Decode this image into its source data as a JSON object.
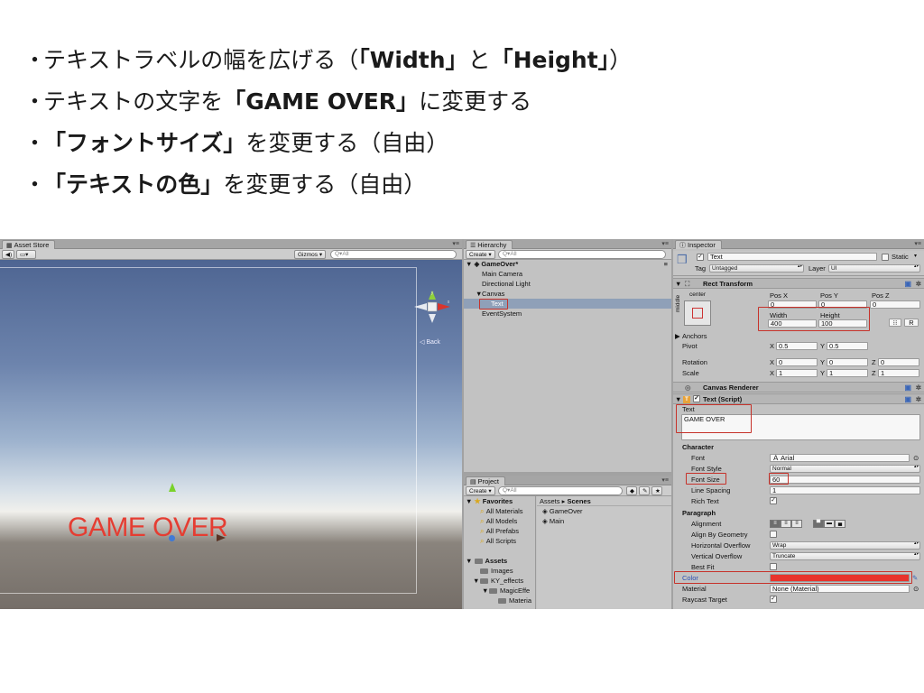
{
  "slide": {
    "bullets": [
      {
        "bullet": "・",
        "parts": [
          {
            "t": "テキストラベルの幅を広げる（",
            "b": false
          },
          {
            "t": "「Width」",
            "b": true
          },
          {
            "t": "と",
            "b": false
          },
          {
            "t": "「Height」",
            "b": true
          },
          {
            "t": "）",
            "b": false
          }
        ]
      },
      {
        "bullet": "・",
        "parts": [
          {
            "t": "テキストの文字を",
            "b": false
          },
          {
            "t": "「GAME OVER」",
            "b": true
          },
          {
            "t": "に変更する",
            "b": false
          }
        ]
      },
      {
        "bullet": "・",
        "parts": [
          {
            "t": "「フォントサイズ」",
            "b": true
          },
          {
            "t": "を変更する（自由）",
            "b": false
          }
        ]
      },
      {
        "bullet": "・",
        "parts": [
          {
            "t": "「テキストの色」",
            "b": true
          },
          {
            "t": "を変更する（自由）",
            "b": false
          }
        ]
      }
    ]
  },
  "scene": {
    "tab": "Asset Store",
    "gizmos": "Gizmos ▾",
    "search_placeholder": "Q▾All",
    "game_text": "GAME OVER",
    "text_color": "#e53d32",
    "back_label": "◁ Back",
    "axis_y": "y",
    "axis_x": "x"
  },
  "hierarchy": {
    "tab": "Hierarchy",
    "create": "Create ▾",
    "search_placeholder": "Q▾All",
    "scene_name": "GameOver*",
    "items": [
      {
        "label": "Main Camera",
        "depth": 1,
        "selected": false
      },
      {
        "label": "Directional Light",
        "depth": 1,
        "selected": false
      },
      {
        "label": "Canvas",
        "depth": 1,
        "selected": false,
        "expand": "▼"
      },
      {
        "label": "Text",
        "depth": 2,
        "selected": true
      },
      {
        "label": "EventSystem",
        "depth": 1,
        "selected": false
      }
    ]
  },
  "project": {
    "tab": "Project",
    "create": "Create ▾",
    "favorites": "Favorites",
    "favorite_items": [
      "All Materials",
      "All Models",
      "All Prefabs",
      "All Scripts"
    ],
    "assets": "Assets",
    "asset_folders": [
      {
        "label": "Images",
        "depth": 1
      },
      {
        "label": "KY_effects",
        "depth": 1,
        "expand": "▼"
      },
      {
        "label": "MagicEffe",
        "depth": 2,
        "expand": "▼"
      },
      {
        "label": "Materia",
        "depth": 3
      }
    ],
    "breadcrumb_root": "Assets",
    "breadcrumb_sep": "▸",
    "breadcrumb_current": "Scenes",
    "scene_files": [
      "GameOver",
      "Main"
    ]
  },
  "inspector": {
    "tab": "Inspector",
    "object_name": "Text",
    "static_label": "Static",
    "tag_label": "Tag",
    "tag_value": "Untagged",
    "layer_label": "Layer",
    "layer_value": "UI",
    "rect_transform": "Rect Transform",
    "anchor_h": "center",
    "anchor_v": "middle",
    "pos_x_label": "Pos X",
    "pos_y_label": "Pos Y",
    "pos_z_label": "Pos Z",
    "pos_x": "0",
    "pos_y": "0",
    "pos_z": "0",
    "width_label": "Width",
    "height_label": "Height",
    "width": "400",
    "height": "100",
    "r_button": "R",
    "anchors_label": "Anchors",
    "pivot_label": "Pivot",
    "pivot_x": "0.5",
    "pivot_y": "0.5",
    "rotation_label": "Rotation",
    "rot_x": "0",
    "rot_y": "0",
    "rot_z": "0",
    "scale_label": "Scale",
    "scale_x": "1",
    "scale_y": "1",
    "scale_z": "1",
    "canvas_renderer": "Canvas Renderer",
    "text_script": "Text (Script)",
    "text_label": "Text",
    "text_value": "GAME OVER",
    "character": "Character",
    "font_label": "Font",
    "font_value": "Arial",
    "font_style_label": "Font Style",
    "font_style_value": "Normal",
    "font_size_label": "Font Size",
    "font_size_value": "60",
    "line_spacing_label": "Line Spacing",
    "line_spacing_value": "1",
    "rich_text_label": "Rich Text",
    "paragraph": "Paragraph",
    "alignment_label": "Alignment",
    "align_by_geometry_label": "Align By Geometry",
    "h_overflow_label": "Horizontal Overflow",
    "h_overflow_value": "Wrap",
    "v_overflow_label": "Vertical Overflow",
    "v_overflow_value": "Truncate",
    "best_fit_label": "Best Fit",
    "color_label": "Color",
    "color_value": "#e8332c",
    "material_label": "Material",
    "material_value": "None (Material)",
    "raycast_label": "Raycast Target",
    "label_x": "X",
    "label_y": "Y",
    "label_z": "Z",
    "check": "✓",
    "cube_icon": "cube-icon",
    "gear_icon": "gear-icon"
  },
  "highlight_color": "#c6322a"
}
